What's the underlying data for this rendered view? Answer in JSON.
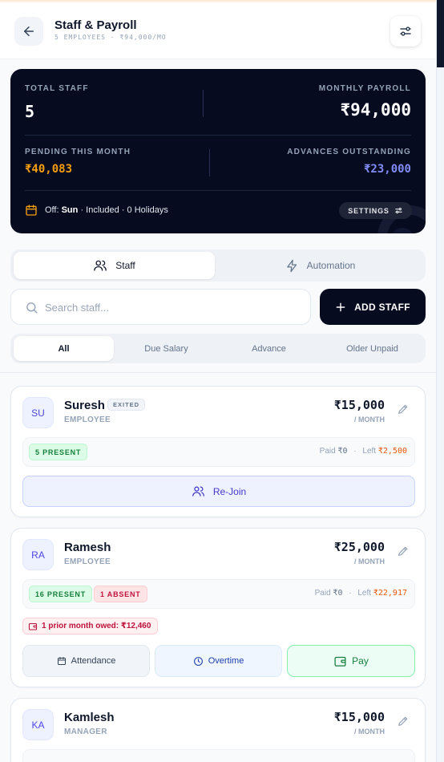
{
  "header": {
    "title": "Staff & Payroll",
    "subtitle": "5 EMPLOYEES · ₹94,000/MO"
  },
  "summary": {
    "total_staff_label": "TOTAL STAFF",
    "total_staff_value": "5",
    "monthly_payroll_label": "MONTHLY PAYROLL",
    "monthly_payroll_value": "₹94,000",
    "pending_label": "PENDING THIS MONTH",
    "pending_value": "₹40,083",
    "advances_label": "ADVANCES OUTSTANDING",
    "advances_value": "₹23,000",
    "off_prefix": "Off:",
    "off_day": "Sun",
    "off_rest": "· Included · 0 Holidays",
    "settings_label": "SETTINGS"
  },
  "tabs": [
    {
      "label": "Staff",
      "icon": "users-icon",
      "active": true
    },
    {
      "label": "Automation",
      "icon": "lightning-icon",
      "active": false
    }
  ],
  "search": {
    "placeholder": "Search staff..."
  },
  "add_staff_label": "ADD STAFF",
  "filters": [
    {
      "label": "All",
      "active": true
    },
    {
      "label": "Due Salary",
      "active": false
    },
    {
      "label": "Advance",
      "active": false
    },
    {
      "label": "Older Unpaid",
      "active": false
    }
  ],
  "staff": [
    {
      "initials": "SU",
      "name": "Suresh",
      "status_tag": "EXITED",
      "role": "EMPLOYEE",
      "salary": "₹15,000",
      "per": "/ MONTH",
      "present": "5 PRESENT",
      "paid_label": "Paid",
      "paid_value": "₹0",
      "left_label": "Left",
      "left_value": "₹2,500",
      "action": "Re-Join"
    },
    {
      "initials": "RA",
      "name": "Ramesh",
      "role": "EMPLOYEE",
      "salary": "₹25,000",
      "per": "/ MONTH",
      "present": "16 PRESENT",
      "absent": "1 ABSENT",
      "paid_label": "Paid",
      "paid_value": "₹0",
      "left_label": "Left",
      "left_value": "₹22,917",
      "owed": "1 prior month owed: ₹12,460",
      "actions": {
        "attendance": "Attendance",
        "overtime": "Overtime",
        "pay": "Pay"
      }
    },
    {
      "initials": "KA",
      "name": "Kamlesh",
      "role": "MANAGER",
      "salary": "₹15,000",
      "per": "/ MONTH"
    }
  ],
  "colors": {
    "dark": "#070b1f",
    "pending": "#f59e0b",
    "advances": "#818cf8",
    "green": "#15803d",
    "red": "#be123c",
    "indigo": "#4f46e5"
  }
}
